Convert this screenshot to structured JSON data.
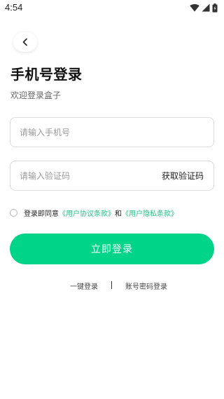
{
  "status_bar": {
    "time": "4:54",
    "icons": [
      "wifi-icon",
      "signal-icon",
      "battery-icon"
    ]
  },
  "back_icon": "chevron-left-icon",
  "title": "手机号登录",
  "subtitle": "欢迎登录盒子",
  "phone_field": {
    "placeholder": "请输入手机号",
    "value": ""
  },
  "code_field": {
    "placeholder": "请输入验证码",
    "value": "",
    "get_code_label": "获取验证码"
  },
  "agreement": {
    "checked": false,
    "prefix": "登录即同意",
    "user_agreement": "《用户协议条款》",
    "conjunction": "和",
    "privacy_policy": "《用户隐私条款》"
  },
  "login_button_label": "立即登录",
  "alt_login": {
    "one_click": "一键登录",
    "separator": "|",
    "password": "账号密码登录"
  },
  "colors": {
    "primary": "#00d489",
    "link": "#27c184",
    "placeholder": "#9a9a9a",
    "border": "#dcdcdc"
  }
}
